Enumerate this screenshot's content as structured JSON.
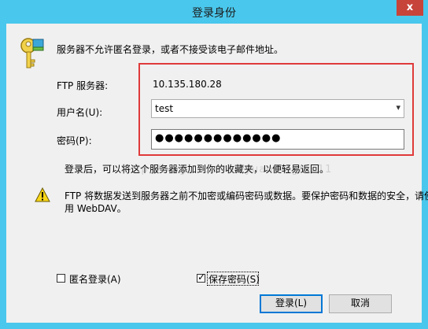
{
  "window": {
    "title": "登录身份",
    "close_glyph": "x"
  },
  "info": {
    "message": "服务器不允许匿名登录，或者不接受该电子邮件地址。"
  },
  "form": {
    "server_label": "FTP 服务器:",
    "server_value": "10.135.180.28",
    "username_label": "用户名(U):",
    "username_value": "test",
    "password_label": "密码(P):",
    "password_value": "●●●●●●●●●●●●●"
  },
  "note": {
    "text": "登录后，可以将这个服务器添加到你的收藏夹，以便轻易返回。"
  },
  "warning": {
    "line1": "FTP 将数据发送到服务器之前不加密或编码密码或数据。要保护密码和数据的安全，请使",
    "line2": "用 WebDAV。"
  },
  "options": {
    "anonymous_label": "匿名登录(A)",
    "anonymous_checked": false,
    "save_password_label": "保存密码(S)",
    "save_password_checked": true,
    "check_glyph": "✓"
  },
  "buttons": {
    "login": "登录(L)",
    "cancel": "取消"
  },
  "watermark": "http://blog.csdn.net/yuanbingtao11"
}
